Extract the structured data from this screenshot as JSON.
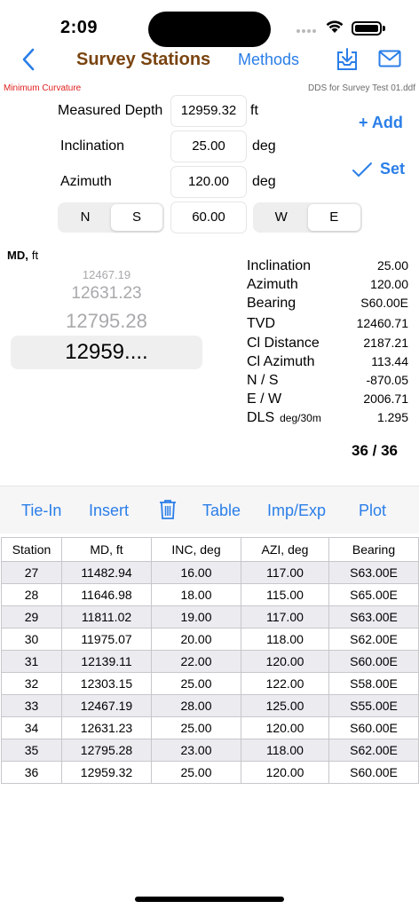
{
  "status": {
    "time": "2:09"
  },
  "nav": {
    "title": "Survey Stations",
    "methods_label": "Methods"
  },
  "info": {
    "method": "Minimum Curvature",
    "file": "DDS for Survey Test 01.ddf"
  },
  "inputs": {
    "md_label": "Measured Depth",
    "md_value": "12959.32",
    "md_unit": "ft",
    "inc_label": "Inclination",
    "inc_value": "25.00",
    "inc_unit": "deg",
    "azi_label": "Azimuth",
    "azi_value": "120.00",
    "azi_unit": "deg",
    "ns_options": [
      "N",
      "S"
    ],
    "ns_selected": "S",
    "bearing_angle": "60.00",
    "ew_options": [
      "W",
      "E"
    ],
    "ew_selected": "E",
    "add_label": "+ Add",
    "set_label": "Set"
  },
  "picker": {
    "label": "MD,",
    "unit": "ft",
    "items": [
      "12467.19",
      "12631.23",
      "12795.28"
    ],
    "selected": "12959...."
  },
  "results": [
    {
      "label": "Inclination",
      "value": "25.00"
    },
    {
      "label": "Azimuth",
      "value": "120.00"
    },
    {
      "label": "Bearing",
      "value": "S60.00E"
    },
    {
      "label": "TVD",
      "value": "12460.71"
    },
    {
      "label": "Cl Distance",
      "value": "2187.21"
    },
    {
      "label": "Cl Azimuth",
      "value": "113.44"
    },
    {
      "label": "N / S",
      "value": "-870.05"
    },
    {
      "label": "E / W",
      "value": "2006.71"
    },
    {
      "label": "DLS",
      "unit": "deg/30m",
      "value": "1.295"
    }
  ],
  "counter": "36 / 36",
  "toolbar": {
    "tiein": "Tie-In",
    "insert": "Insert",
    "table": "Table",
    "impexp": "Imp/Exp",
    "plot": "Plot"
  },
  "table": {
    "headers": [
      "Station",
      "MD, ft",
      "INC, deg",
      "AZI, deg",
      "Bearing"
    ],
    "rows": [
      [
        "27",
        "11482.94",
        "16.00",
        "117.00",
        "S63.00E"
      ],
      [
        "28",
        "11646.98",
        "18.00",
        "115.00",
        "S65.00E"
      ],
      [
        "29",
        "11811.02",
        "19.00",
        "117.00",
        "S63.00E"
      ],
      [
        "30",
        "11975.07",
        "20.00",
        "118.00",
        "S62.00E"
      ],
      [
        "31",
        "12139.11",
        "22.00",
        "120.00",
        "S60.00E"
      ],
      [
        "32",
        "12303.15",
        "25.00",
        "122.00",
        "S58.00E"
      ],
      [
        "33",
        "12467.19",
        "28.00",
        "125.00",
        "S55.00E"
      ],
      [
        "34",
        "12631.23",
        "25.00",
        "120.00",
        "S60.00E"
      ],
      [
        "35",
        "12795.28",
        "23.00",
        "118.00",
        "S62.00E"
      ],
      [
        "36",
        "12959.32",
        "25.00",
        "120.00",
        "S60.00E"
      ]
    ]
  },
  "colors": {
    "accent": "#2a7ee8",
    "title": "#7a4410",
    "method": "#e02020"
  }
}
